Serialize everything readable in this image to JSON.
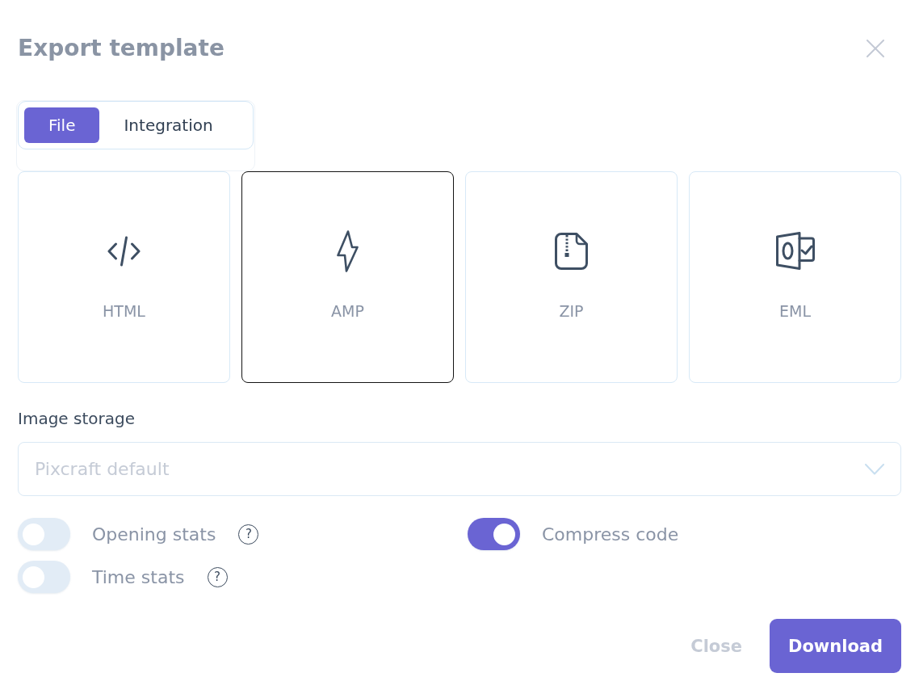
{
  "dialog": {
    "title": "Export template"
  },
  "tabs": [
    {
      "label": "File",
      "selected": true
    },
    {
      "label": "Integration",
      "selected": false
    }
  ],
  "formats": [
    {
      "label": "HTML",
      "kind": "code",
      "selected": false
    },
    {
      "label": "AMP",
      "kind": "bolt",
      "selected": true
    },
    {
      "label": "ZIP",
      "kind": "zip",
      "selected": false
    },
    {
      "label": "EML",
      "kind": "mail",
      "selected": false
    }
  ],
  "image_storage": {
    "label": "Image storage",
    "placeholder": "Pixcraft default"
  },
  "options": [
    {
      "label": "Opening stats",
      "on": false,
      "help": "?"
    },
    {
      "label": "Compress code",
      "on": true
    },
    {
      "label": "Time stats",
      "on": false,
      "help": "?"
    }
  ],
  "buttons": [
    {
      "label": "Close",
      "kind": "secondary"
    },
    {
      "label": "Download",
      "kind": "primary"
    }
  ]
}
